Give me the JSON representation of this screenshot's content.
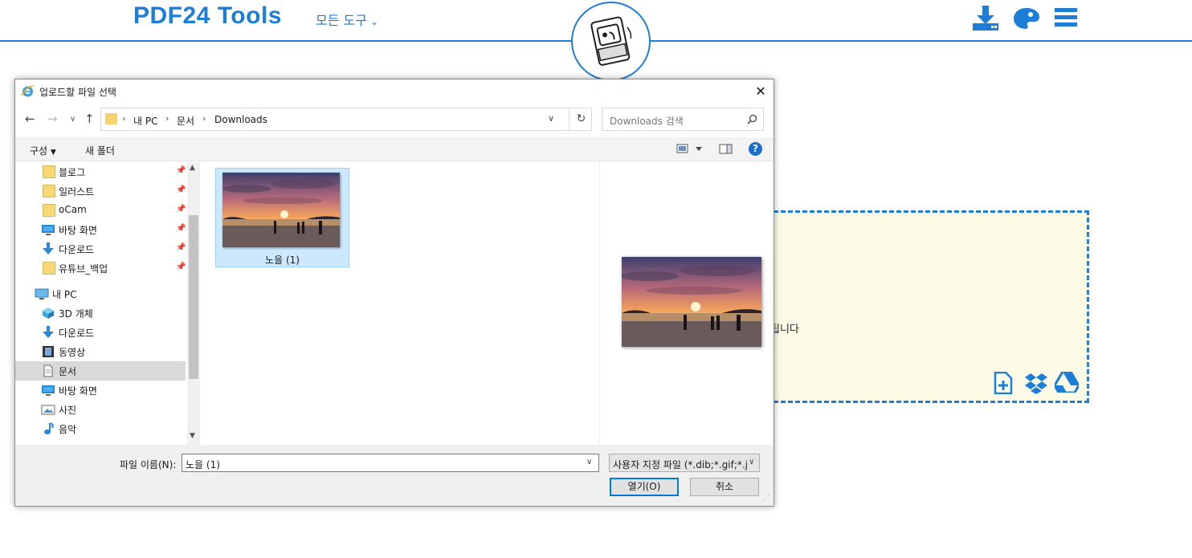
{
  "site": {
    "brand": "PDF24 Tools",
    "tools_menu": "모든 도구",
    "dropzone_text": "됩니다"
  },
  "dialog": {
    "title": "업로드할 파일 선택",
    "breadcrumb": [
      "내 PC",
      "문서",
      "Downloads"
    ],
    "search_placeholder": "Downloads 검색",
    "commands": {
      "organize": "구성",
      "new_folder": "새 폴더"
    },
    "nav_items": [
      {
        "label": "블로그",
        "icon": "folder-icon",
        "pinned": true
      },
      {
        "label": "일러스트",
        "icon": "folder-icon",
        "pinned": true
      },
      {
        "label": "oCam",
        "icon": "folder-icon",
        "pinned": true
      },
      {
        "label": "바탕 화면",
        "icon": "desktop-icon",
        "pinned": true
      },
      {
        "label": "다운로드",
        "icon": "download-arrow-icon",
        "pinned": true
      },
      {
        "label": "유튜브_백업",
        "icon": "folder-icon",
        "pinned": true
      },
      {
        "label": "내 PC",
        "icon": "computer-icon",
        "pinned": false
      },
      {
        "label": "3D 개체",
        "icon": "cube-icon",
        "pinned": false
      },
      {
        "label": "다운로드",
        "icon": "download-arrow-icon",
        "pinned": false
      },
      {
        "label": "동영상",
        "icon": "film-icon",
        "pinned": false
      },
      {
        "label": "문서",
        "icon": "document-icon",
        "pinned": false
      },
      {
        "label": "바탕 화면",
        "icon": "desktop-icon",
        "pinned": false
      },
      {
        "label": "사진",
        "icon": "picture-icon",
        "pinned": false
      },
      {
        "label": "음악",
        "icon": "music-icon",
        "pinned": false
      }
    ],
    "selected_nav": "문서",
    "files": [
      {
        "name": "노을 (1)",
        "selected": true
      }
    ],
    "file_name_label": "파일 이름(N):",
    "file_name_value": "노을 (1)",
    "file_type_filter": "사용자 지정 파일 (*.dib;*.gif;*.j",
    "open_button": "열기(O)",
    "cancel_button": "취소"
  },
  "colors": {
    "brand_blue": "#1d7ed8",
    "dropzone_bg": "#fdfbe6",
    "selection": "#cce8ff"
  }
}
